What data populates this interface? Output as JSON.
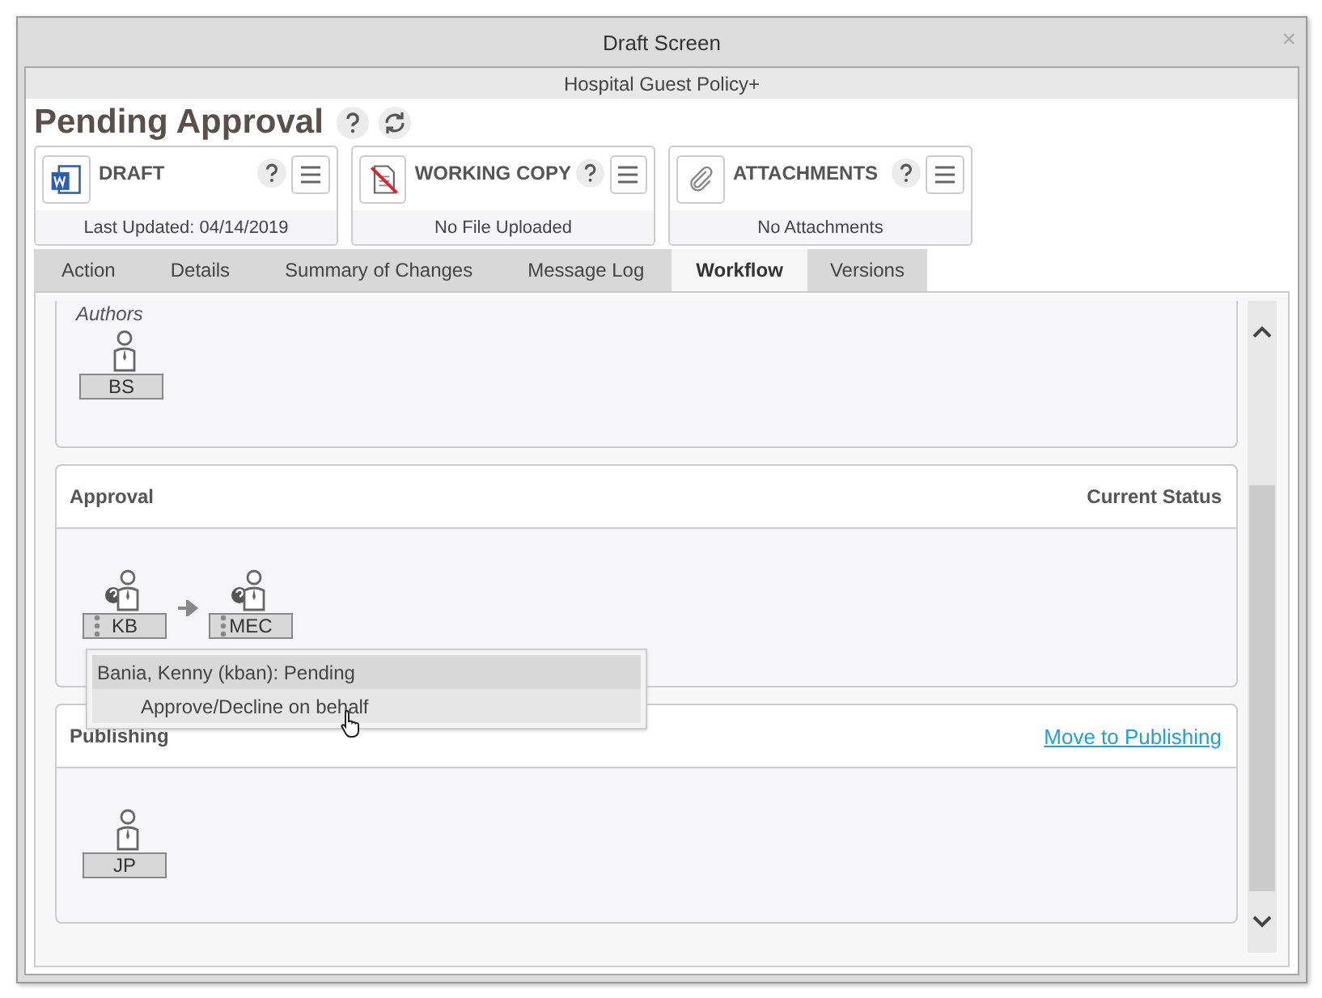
{
  "window": {
    "title": "Draft Screen",
    "close": "×"
  },
  "subtitle": "Hospital Guest Policy+",
  "heading": "Pending Approval",
  "cards": [
    {
      "kind": "word",
      "title": "DRAFT",
      "footer": "Last Updated: 04/14/2019"
    },
    {
      "kind": "nofile",
      "title": "WORKING COPY",
      "footer": "No File Uploaded"
    },
    {
      "kind": "clip",
      "title": "ATTACHMENTS",
      "footer": "No Attachments"
    }
  ],
  "tabs": [
    {
      "label": "Action",
      "selected": false
    },
    {
      "label": "Details",
      "selected": false
    },
    {
      "label": "Summary of Changes",
      "selected": false
    },
    {
      "label": "Message Log",
      "selected": false
    },
    {
      "label": "Workflow",
      "selected": true
    },
    {
      "label": "Versions",
      "selected": false
    }
  ],
  "authors": {
    "label": "Authors",
    "people": [
      {
        "initials": "BS",
        "awaiting": false
      }
    ]
  },
  "approval": {
    "title": "Approval",
    "status_label": "Current Status",
    "people": [
      {
        "initials": "KB",
        "awaiting": true
      },
      {
        "initials": "MEC",
        "awaiting": true
      }
    ],
    "popup": {
      "header": "Bania, Kenny (kban): Pending",
      "item": "Approve/Decline on behalf"
    }
  },
  "publishing": {
    "title": "Publishing",
    "link": "Move to Publishing",
    "people": [
      {
        "initials": "JP",
        "awaiting": false
      }
    ]
  }
}
